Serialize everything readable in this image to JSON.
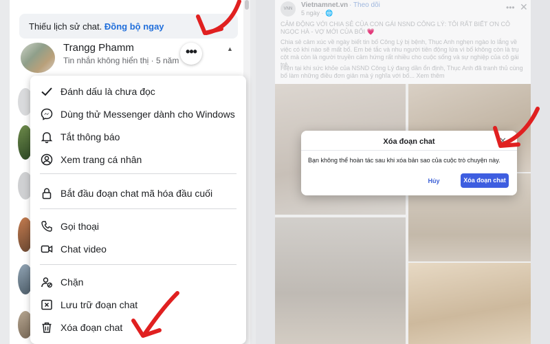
{
  "left_panel": {
    "sync_banner": {
      "text": "Thiếu lịch sử chat.",
      "link": "Đồng bộ ngay"
    },
    "contact": {
      "name": "Trangg Phamm",
      "subtitle": "Tin nhắn không hiển thị · 5 năm",
      "more_label": "•••"
    },
    "menu": {
      "items": [
        {
          "label": "Đánh dấu là chưa đọc",
          "icon": "checkmark-icon"
        },
        {
          "label": "Dùng thử Messenger dành cho Windows",
          "icon": "messenger-icon"
        },
        {
          "label": "Tắt thông báo",
          "icon": "bell-icon"
        },
        {
          "label": "Xem trang cá nhân",
          "icon": "profile-icon"
        },
        {
          "label": "Bắt đầu đoạn chat mã hóa đầu cuối",
          "icon": "lock-icon"
        },
        {
          "label": "Gọi thoại",
          "icon": "phone-icon"
        },
        {
          "label": "Chat video",
          "icon": "video-icon"
        },
        {
          "label": "Chặn",
          "icon": "block-user-icon"
        },
        {
          "label": "Lưu trữ đoạn chat",
          "icon": "archive-icon"
        },
        {
          "label": "Xóa đoạn chat",
          "icon": "trash-icon"
        }
      ]
    }
  },
  "right_panel": {
    "post": {
      "page_name": "Vietnamnet.vn",
      "follow": "· Theo dõi",
      "time": "5 ngày · 🌐",
      "logo_text": "VNN",
      "more": "•••",
      "close": "✕",
      "headline": "CẢM ĐỘNG VỚI CHIA SẺ CỦA CON GÁI NSND CÔNG LÝ: TÔI RẤT BIẾT ƠN CÔ NGỌC HÀ - VỢ MỚI CỦA BỐI 💗",
      "paragraph1": "Chia sẻ cảm xúc về ngày biết tin bố Công Lý bị bệnh, Thục Anh nghẹn ngào lo lắng về việc có khi nào sẽ mất bố. Em bé tắc và nhu người tiên động lứa vì bố không còn là trụ cột mà còn là người truyền cảm hứng rất nhiều cho cuộc sống và sự nghiệp của cô gái trẻ.",
      "paragraph2": "Hiện tại khi sức khỏe của NSND Công Lý đang dần ổn định, Thục Anh đã tranh thủ cùng bố làm những điều đơn giản mà ý nghĩa với bố... Xem thêm"
    },
    "dialog": {
      "title": "Xóa đoạn chat",
      "close": "✕",
      "body": "Bạn không thể hoàn tác sau khi xóa bản sao của cuộc trò chuyện này.",
      "cancel": "Hủy",
      "confirm": "Xóa đoạn chat"
    }
  },
  "colors": {
    "accent": "#3e5ee0",
    "link": "#216fdb",
    "annotation_arrow": "#e02020"
  }
}
